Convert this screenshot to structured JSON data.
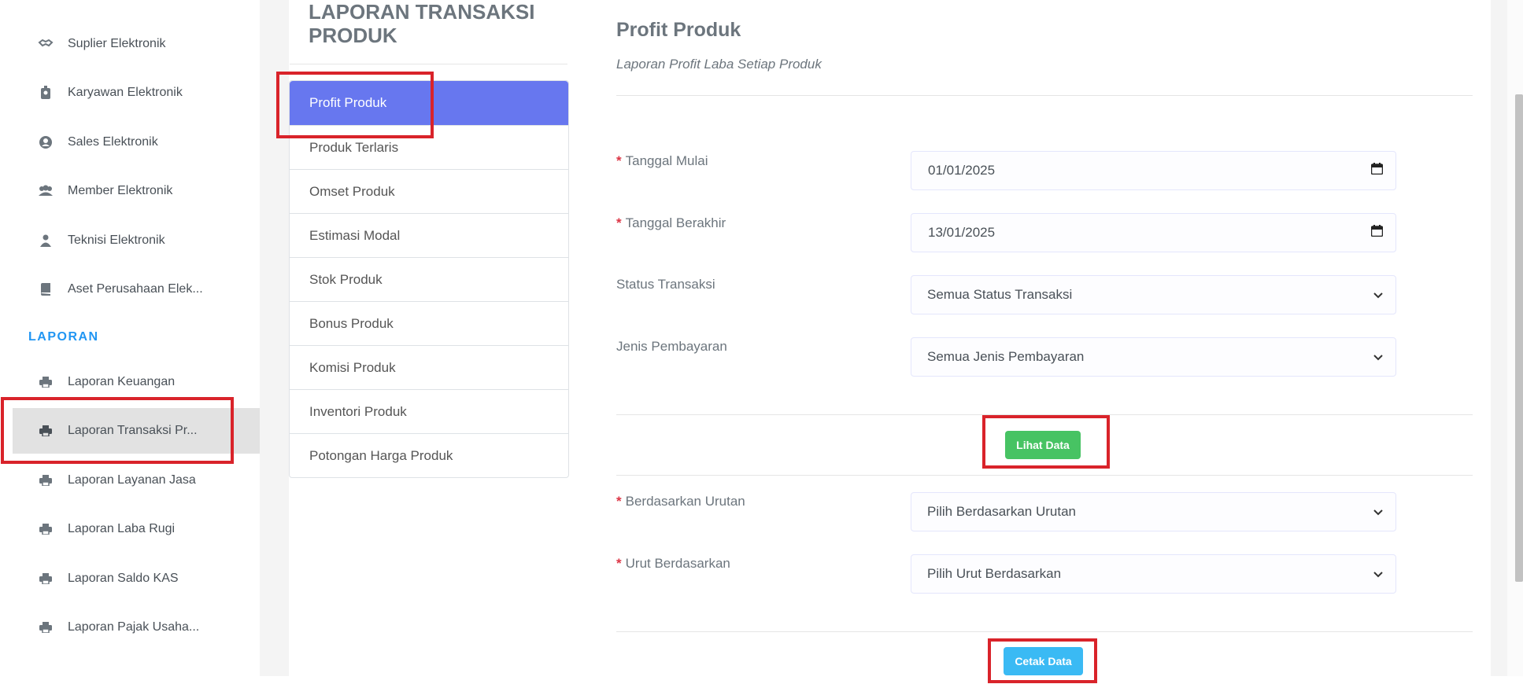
{
  "sidebar": {
    "items": [
      {
        "label": "Suplier Elektronik",
        "icon": "handshake-icon"
      },
      {
        "label": "Karyawan Elektronik",
        "icon": "id-badge-icon"
      },
      {
        "label": "Sales Elektronik",
        "icon": "user-circle-icon"
      },
      {
        "label": "Member Elektronik",
        "icon": "users-icon"
      },
      {
        "label": "Teknisi Elektronik",
        "icon": "user-icon"
      },
      {
        "label": "Aset Perusahaan Elek...",
        "icon": "book-icon"
      }
    ],
    "section_header": "LAPORAN",
    "report_items": [
      {
        "label": "Laporan Keuangan",
        "icon": "print-icon"
      },
      {
        "label": "Laporan Transaksi Pr...",
        "icon": "print-icon",
        "active": true
      },
      {
        "label": "Laporan Layanan Jasa",
        "icon": "print-icon"
      },
      {
        "label": "Laporan Laba Rugi",
        "icon": "print-icon"
      },
      {
        "label": "Laporan Saldo KAS",
        "icon": "print-icon"
      },
      {
        "label": "Laporan Pajak Usaha...",
        "icon": "print-icon"
      }
    ]
  },
  "panel": {
    "title": "LAPORAN TRANSAKSI PRODUK",
    "menu": [
      "Profit Produk",
      "Produk Terlaris",
      "Omset Produk",
      "Estimasi Modal",
      "Stok Produk",
      "Bonus Produk",
      "Komisi Produk",
      "Inventori Produk",
      "Potongan Harga Produk"
    ],
    "active_menu": "Profit Produk"
  },
  "content": {
    "title": "Profit Produk",
    "subtitle": "Laporan Profit Laba Setiap Produk",
    "required_marker": "*",
    "fields": {
      "tanggal_mulai": {
        "label": "Tanggal Mulai",
        "value": "01/01/2025"
      },
      "tanggal_berakhir": {
        "label": "Tanggal Berakhir",
        "value": "13/01/2025"
      },
      "status_transaksi": {
        "label": "Status Transaksi",
        "value": "Semua Status Transaksi"
      },
      "jenis_pembayaran": {
        "label": "Jenis Pembayaran",
        "value": "Semua Jenis Pembayaran"
      },
      "berdasarkan_urutan": {
        "label": "Berdasarkan Urutan",
        "value": "Pilih Berdasarkan Urutan"
      },
      "urut_berdasarkan": {
        "label": "Urut Berdasarkan",
        "value": "Pilih Urut Berdasarkan"
      }
    },
    "buttons": {
      "lihat_data": "Lihat Data",
      "cetak_data": "Cetak Data"
    }
  },
  "colors": {
    "accent": "#6777ef",
    "success": "#47c363",
    "info": "#3abaf4",
    "required": "#dc3545",
    "highlight": "#d9232a",
    "section": "#2196f3"
  }
}
